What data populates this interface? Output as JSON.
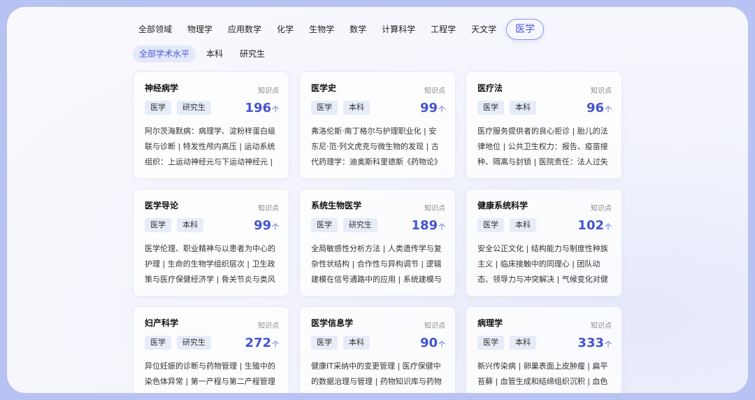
{
  "fields": [
    "全部领域",
    "物理学",
    "应用数学",
    "化学",
    "生物学",
    "数学",
    "计算科学",
    "工程学",
    "天文学",
    "医学"
  ],
  "active_field": 9,
  "levels": [
    "全部学术水平",
    "本科",
    "研究生"
  ],
  "active_level": 0,
  "kp_label": "知识点",
  "unit": "个",
  "cards": [
    {
      "title": "神经病学",
      "tags": [
        "医学",
        "研究生"
      ],
      "count": "196",
      "desc": "阿尔茨海默病：病理学、淀粉样蛋白级联与诊断 | 特发性颅内高压 | 运动系统组织：上运动神经元与下运动神经元 |"
    },
    {
      "title": "医学史",
      "tags": [
        "医学",
        "本科"
      ],
      "count": "99",
      "desc": "弗洛伦斯·南丁格尔与护理职业化 | 安东尼·范·列文虎克与微生物的发现 | 古代药理学：迪奥斯科里德斯《药物论》 |"
    },
    {
      "title": "医疗法",
      "tags": [
        "医学",
        "本科"
      ],
      "count": "96",
      "desc": "医疗服务提供者的良心拒诊 | 胎儿的法律地位 | 公共卫生权力：报告、疫苗接种、隔离与封锁 | 医院责任：法人过失 |"
    },
    {
      "title": "医学导论",
      "tags": [
        "医学",
        "本科"
      ],
      "count": "99",
      "desc": "医学伦理、职业精神与以患者为中心的护理 | 生命的生物学组织层次 | 卫生政策与医疗保健经济学 | 骨关节炎与类风"
    },
    {
      "title": "系统生物医学",
      "tags": [
        "医学",
        "研究生"
      ],
      "count": "189",
      "desc": "全局敏感性分析方法 | 人类遗传学与复杂性状结构 | 合作性与异构调节 | 逻辑建模在信号通路中的应用 | 系统建模与"
    },
    {
      "title": "健康系统科学",
      "tags": [
        "医学",
        "本科"
      ],
      "count": "102",
      "desc": "安全公正文化 | 结构能力与制度性种族主义 | 临床接触中的同理心 | 团队动态、领导力与冲突解决 | 气候变化对健"
    },
    {
      "title": "妇产科学",
      "tags": [
        "医学",
        "研究生"
      ],
      "count": "272",
      "desc": "异位妊娠的诊断与药物管理 | 生殖中的染色体异常 | 第一产程与第二产程管理 |"
    },
    {
      "title": "医学信息学",
      "tags": [
        "医学",
        "本科"
      ],
      "count": "90",
      "desc": "健康IT采纳中的变更管理 | 医疗保健中的数据治理与管理 | 药物知识库与药物"
    },
    {
      "title": "病理学",
      "tags": [
        "医学",
        "本科"
      ],
      "count": "333",
      "desc": "新兴传染病 | 卵巢表面上皮肿瘤 | 扁平苔藓 | 血管生成和结缔组织沉积 | 血色"
    }
  ]
}
